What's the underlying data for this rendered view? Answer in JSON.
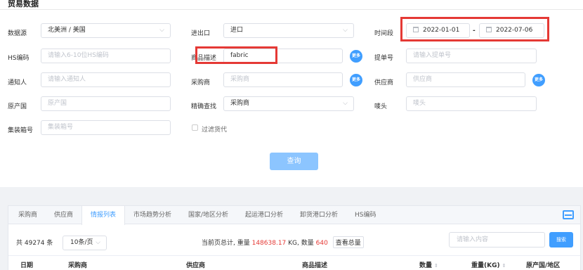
{
  "page_title": "贸易数据",
  "form": {
    "source_label": "数据源",
    "source_value": "北美洲 / 美国",
    "imex_label": "进出口",
    "imex_value": "进口",
    "period_label": "时间段",
    "date_start": "2022-01-01",
    "date_sep": "-",
    "date_end": "2022-07-06",
    "hs_label": "HS编码",
    "hs_placeholder": "请输入6-10位HS编码",
    "desc_label": "商品描述",
    "desc_value": "fabric",
    "more_label": "更多",
    "bill_label": "提单号",
    "bill_placeholder": "请输入提单号",
    "notify_label": "通知人",
    "notify_placeholder": "请输入通知人",
    "buyer_label": "采购商",
    "buyer_placeholder": "采购商",
    "supplier_label": "供应商",
    "supplier_placeholder": "供应商",
    "origin_label": "原产国",
    "origin_placeholder": "原产国",
    "precise_label": "精确查找",
    "precise_value": "采购商",
    "mark_label": "唛头",
    "mark_placeholder": "唛头",
    "container_label": "集装箱号",
    "container_placeholder": "集装箱号",
    "filter_label": "过滤货代",
    "query_button": "查询"
  },
  "tabs": [
    "采购商",
    "供应商",
    "情报列表",
    "市场趋势分析",
    "国家/地区分析",
    "起运港口分析",
    "卸货港口分析",
    "HS编码"
  ],
  "active_tab": "情报列表",
  "results": {
    "total_text": "共 49274 条",
    "page_size": "10条/页",
    "summary_prefix": "当前页总计, 重量",
    "weight_value": "148638.17",
    "weight_unit": "KG, 数量",
    "qty_value": "640",
    "view_total": "查看总量",
    "search_placeholder": "请输入内容",
    "search_button": "搜索"
  },
  "table_headers": {
    "date": "日期",
    "buyer": "采购商",
    "supplier": "供应商",
    "desc": "商品描述",
    "qty": "数量",
    "weight": "重量(KG)",
    "origin": "原产国/地区"
  },
  "annotation_color": "#e53935",
  "accent_color": "#409eff"
}
